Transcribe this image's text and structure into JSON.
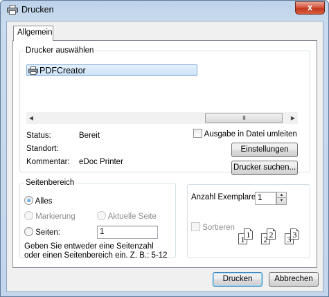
{
  "window": {
    "title": "Drucken",
    "close_label": "x"
  },
  "tabs": [
    {
      "label": "Allgemein"
    }
  ],
  "printer_select": {
    "legend": "Drucker auswählen",
    "printers": [
      {
        "name": "PDFCreator",
        "selected": true
      }
    ],
    "scroll_thumb_grip": "III",
    "status_label": "Status:",
    "status_value": "Bereit",
    "location_label": "Standort:",
    "location_value": "",
    "comment_label": "Kommentar:",
    "comment_value": "eDoc Printer",
    "print_to_file_label": "Ausgabe in Datei umleiten",
    "print_to_file_checked": false,
    "settings_button": "Einstellungen",
    "find_printer_button": "Drucker suchen..."
  },
  "page_range": {
    "legend": "Seitenbereich",
    "all_label": "Alles",
    "all_checked": true,
    "selection_label": "Markierung",
    "current_page_label": "Aktuelle Seite",
    "pages_label": "Seiten:",
    "pages_value": "1",
    "hint": "Geben Sie entweder eine Seitenzahl oder einen Seitenbereich ein. Z. B.: 5-12"
  },
  "copies": {
    "label": "Anzahl Exemplare:",
    "value": "1",
    "collate_label": "Sortieren",
    "collate_checked": false,
    "collate_pages": [
      "1",
      "1",
      "2",
      "2",
      "3",
      "3"
    ]
  },
  "footer": {
    "print_button": "Drucken",
    "cancel_button": "Abbrechen"
  },
  "colors": {
    "titlebar": "#c3d6eb",
    "close_button": "#c1371d",
    "selection": "#cbe3f9",
    "default_button_border": "#3c7fb1"
  }
}
